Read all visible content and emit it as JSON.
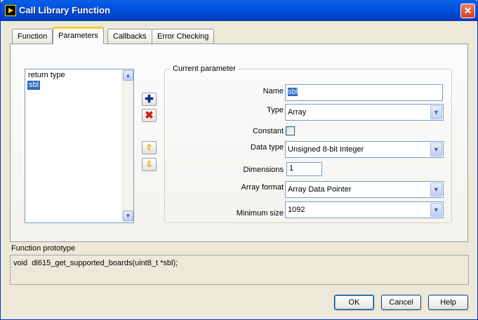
{
  "window": {
    "title": "Call Library Function"
  },
  "tabs": [
    {
      "label": "Function"
    },
    {
      "label": "Parameters"
    },
    {
      "label": "Callbacks"
    },
    {
      "label": "Error Checking"
    }
  ],
  "parameter_list": {
    "items": [
      {
        "label": "return type"
      },
      {
        "label": "sbl"
      }
    ],
    "selected": "sbl"
  },
  "current_parameter": {
    "group_title": "Current parameter",
    "name_label": "Name",
    "name_value": "sbl",
    "type_label": "Type",
    "type_value": "Array",
    "constant_label": "Constant",
    "constant_checked": false,
    "data_type_label": "Data type",
    "data_type_value": "Unsigned 8-bit Integer",
    "dimensions_label": "Dimensions",
    "dimensions_value": "1",
    "array_format_label": "Array format",
    "array_format_value": "Array Data Pointer",
    "minimum_size_label": "Minimum size",
    "minimum_size_value": "1092"
  },
  "toolbar_icons": [
    "add-icon",
    "delete-icon",
    "move-up-icon",
    "move-down-icon"
  ],
  "function_prototype": {
    "label": "Function prototype",
    "value": "void  dl615_get_supported_boards(uint8_t *sbl);"
  },
  "buttons": {
    "ok": "OK",
    "cancel": "Cancel",
    "help": "Help"
  },
  "colors": {
    "titlebar": "#0053e1",
    "selection": "#316ac5",
    "active_tab_accent": "#ffc83c",
    "delete_icon": "#d11a1a",
    "add_icon": "#0a2a8a"
  }
}
